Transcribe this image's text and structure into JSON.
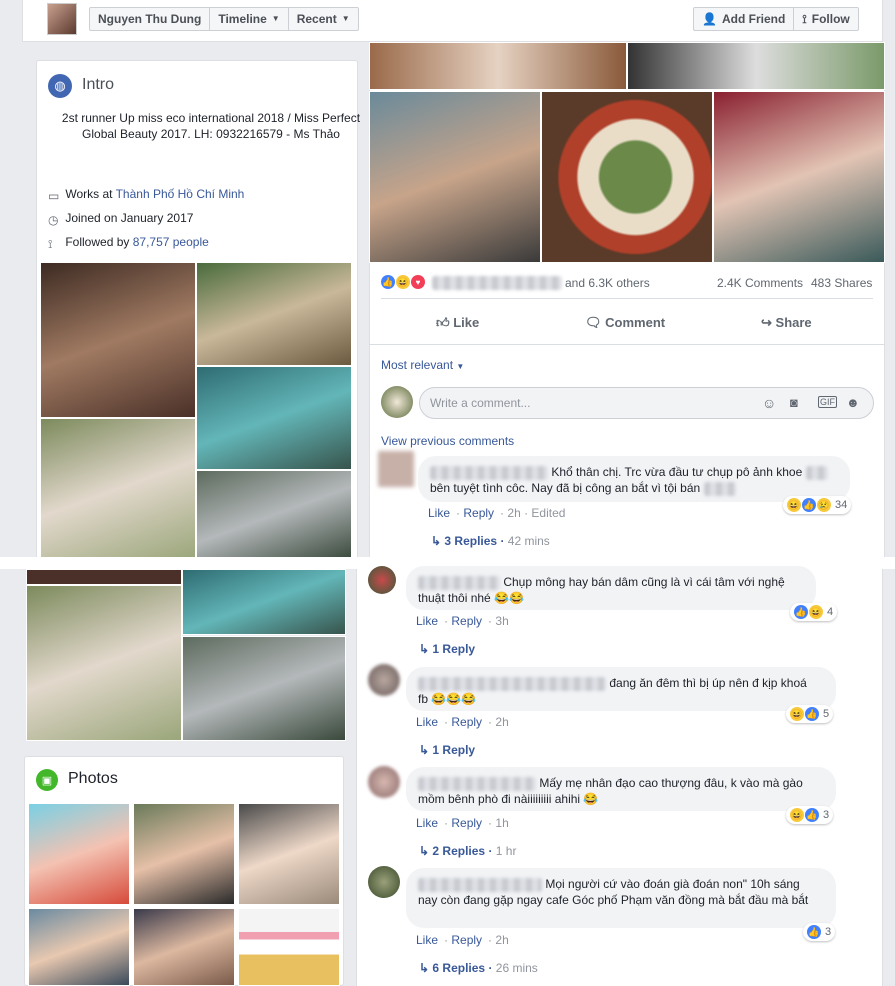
{
  "topbar": {
    "profile_name": "Nguyen Thu Dung",
    "timeline_label": "Timeline",
    "recent_label": "Recent",
    "add_friend_label": "Add Friend",
    "follow_label": "Follow"
  },
  "intro": {
    "title": "Intro",
    "bio": "2st runner Up miss eco international 2018 / Miss Perfect Global Beauty 2017. LH: 0932216579 - Ms Thảo",
    "works_prefix": "Works at ",
    "works_place": "Thành Phố Hồ Chí Minh",
    "joined": "Joined on January 2017",
    "followed_prefix": "Followed by ",
    "followed_count": "87,757 people"
  },
  "photos": {
    "title": "Photos"
  },
  "post": {
    "others": "and 6.3K others",
    "comments_count": "2.4K Comments",
    "shares_count": "483 Shares",
    "like_label": "Like",
    "comment_label": "Comment",
    "share_label": "Share",
    "sort_label": "Most relevant",
    "comment_placeholder": "Write a comment...",
    "view_previous": "View previous comments"
  },
  "comments": [
    {
      "text_a": "Khổ thân chị. Trc vừa đầu tư chụp pô ảnh khoe",
      "text_b": "bên tuyệt tình côc. Nay đã bị công an bắt vì tội bán",
      "like": "Like",
      "reply": "Reply",
      "time": "2h",
      "edited": "Edited",
      "reactions": "34",
      "replies": "3 Replies",
      "replies_time": "42 mins"
    },
    {
      "text": "Chụp mông hay bán dâm cũng là vì cái tâm với nghệ thuật thôi nhé 😂😂",
      "like": "Like",
      "reply": "Reply",
      "time": "3h",
      "reactions": "4",
      "replies": "1 Reply",
      "replies_time": ""
    },
    {
      "text_a": "đang ăn đêm thì bị úp nên đ kịp khoá",
      "text_b": "fb 😂😂😂",
      "like": "Like",
      "reply": "Reply",
      "time": "2h",
      "reactions": "5",
      "replies": "1 Reply",
      "replies_time": ""
    },
    {
      "text_a": "Mấy mẹ nhân đạo cao thượng đâu, k vào mà gào",
      "text_b": "mồm bênh phò đi nàiiiiiiiii ahihi 😂",
      "like": "Like",
      "reply": "Reply",
      "time": "1h",
      "reactions": "3",
      "replies": "2 Replies",
      "replies_time": "1 hr"
    },
    {
      "text_a": "Mọi người cứ vào đoán già đoán non\" 10h sáng",
      "text_b": "nay còn đang gặp ngay cafe Góc phố Phạm văn đồng mà bắt đầu mà bắt",
      "like": "Like",
      "reply": "Reply",
      "time": "2h",
      "reactions": "3",
      "replies": "6 Replies",
      "replies_time": "26 mins"
    }
  ],
  "colors": {
    "link": "#385898",
    "accent": "#4080ff",
    "bg": "#e9ebee"
  }
}
